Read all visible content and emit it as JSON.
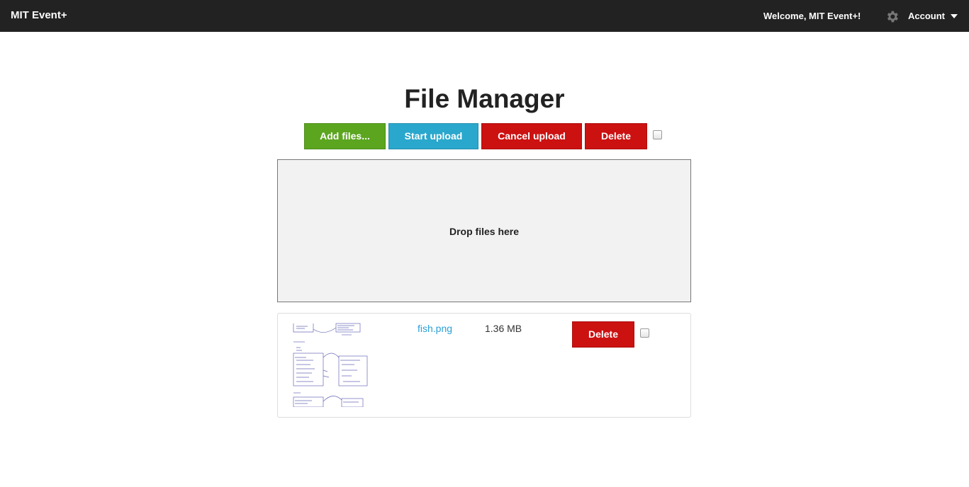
{
  "navbar": {
    "brand": "MIT Event+",
    "welcome": "Welcome, MIT Event+!",
    "account_label": "Account",
    "icons": {
      "settings": "gear-icon",
      "dropdown": "caret-down-icon"
    }
  },
  "page": {
    "title": "File Manager"
  },
  "toolbar": {
    "add_files": "Add files...",
    "start_upload": "Start upload",
    "cancel_upload": "Cancel upload",
    "delete": "Delete",
    "select_all_checked": false
  },
  "dropzone": {
    "text": "Drop files here"
  },
  "files": [
    {
      "name": "fish.png",
      "size": "1.36 MB",
      "delete_label": "Delete",
      "checked": false,
      "thumbnail": "sketch-thumbnail"
    }
  ],
  "colors": {
    "navbar": "#222222",
    "success": "#5ba51f",
    "info": "#2aa7cc",
    "danger": "#cc1111",
    "link": "#2a9fd6",
    "dropzone_bg": "#f2f2f2"
  }
}
